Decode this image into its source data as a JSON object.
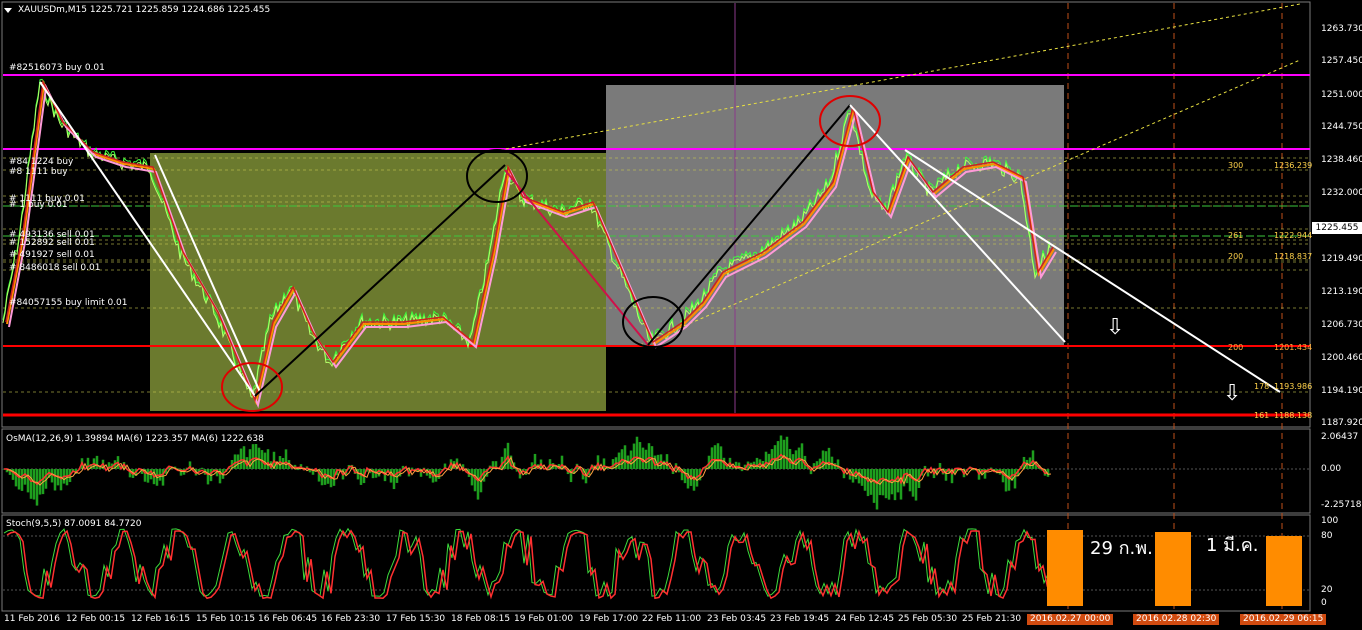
{
  "chart_header": {
    "title": "XAUUSDm,M15",
    "ohlc": "1225.721 1225.859 1224.686 1225.455"
  },
  "price_axis": {
    "labels": [
      "1263.730",
      "1257.450",
      "1251.000",
      "1244.750",
      "1238.460",
      "1232.000",
      "1225.455",
      "1219.490",
      "1213.190",
      "1206.730",
      "1200.460",
      "1194.190",
      "1187.920"
    ],
    "current_price": "1225.455"
  },
  "time_axis": {
    "labels": [
      "11 Feb 2016",
      "12 Feb 00:15",
      "12 Feb 16:15",
      "15 Feb 10:15",
      "16 Feb 06:45",
      "16 Feb 23:30",
      "17 Feb 15:30",
      "18 Feb 08:15",
      "19 Feb 01:00",
      "19 Feb 17:00",
      "22 Feb 11:00",
      "23 Feb 03:45",
      "23 Feb 19:45",
      "24 Feb 12:45",
      "25 Feb 05:30",
      "25 Feb 21:30"
    ],
    "highlighted_dates": [
      "2016.02.27 00:00",
      "2016.02.28 02:30",
      "2016.02.29 06:15"
    ]
  },
  "orders": [
    "#82516073 buy 0.01",
    "#84   1224 buy",
    "#8    1111 buy",
    "#        1111 buy 0.01",
    "#      1   buy 0.01",
    "#  493136 sell 0.01",
    "#  152892 sell 0.01",
    "#  491927 sell 0.01",
    "#  8486018 sell 0.01",
    "#84057155 buy limit 0.01"
  ],
  "fib_levels": [
    {
      "pct": "300",
      "price": "1236.239"
    },
    {
      "pct": "261",
      "price": "1222.944"
    },
    {
      "pct": "200",
      "price": "1218.837"
    },
    {
      "pct": "200",
      "price": "1201.434"
    },
    {
      "pct": "178",
      "price": "1193.986"
    },
    {
      "pct": "161",
      "price": "1188.138"
    }
  ],
  "osma": {
    "label": "OsMA(12,26,9) 1.39894  MA(6) 1223.357  MA(6) 1222.638",
    "axis": [
      "2.06437",
      "0.00",
      "-2.25718"
    ]
  },
  "stoch": {
    "label": "Stoch(9,5,5) 87.0091 84.7720",
    "axis": [
      "100",
      "80",
      "20",
      "0"
    ]
  },
  "annotations": {
    "feb29": "29 ก.พ.",
    "mar1": "1 มี.ค."
  },
  "colors": {
    "background": "#000000",
    "magenta_line": "#ff00ff",
    "red_line": "#ff0000",
    "olive_box": "#6b7a2e",
    "gray_box": "#7a7a7a",
    "orange_bar": "#ff8c00",
    "osma_hist": "#1e9e1e",
    "fib_label": "#ffd24a"
  }
}
